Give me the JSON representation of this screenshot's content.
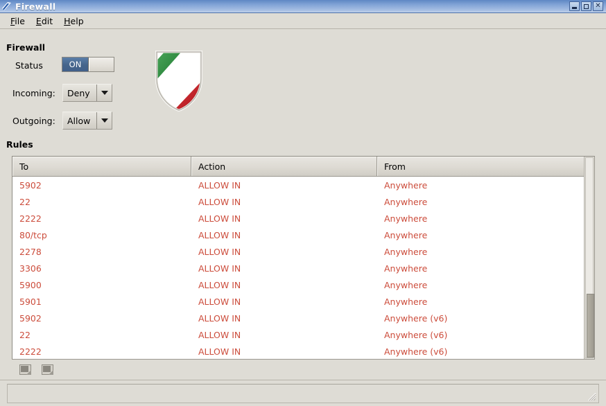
{
  "window": {
    "title": "Firewall",
    "icon": "firewall-app-icon",
    "controls": {
      "minimize": "minimize-icon",
      "maximize": "maximize-icon",
      "close": "close-icon"
    }
  },
  "menubar": {
    "items": [
      {
        "label": "File",
        "mnemonic": "F"
      },
      {
        "label": "Edit",
        "mnemonic": "E"
      },
      {
        "label": "Help",
        "mnemonic": "H"
      }
    ]
  },
  "firewall": {
    "section_title": "Firewall",
    "status": {
      "label": "Status",
      "toggle_value": "ON",
      "enabled": true
    },
    "incoming": {
      "label": "Incoming:",
      "value": "Deny"
    },
    "outgoing": {
      "label": "Outgoing:",
      "value": "Allow"
    },
    "logo": {
      "name": "shield-logo",
      "colors": {
        "green": "#3f9a4e",
        "white": "#ffffff",
        "red": "#c7262b"
      }
    }
  },
  "rules": {
    "section_title": "Rules",
    "columns": [
      "To",
      "Action",
      "From"
    ],
    "rows": [
      {
        "to": "5902",
        "action": "ALLOW IN",
        "from": "Anywhere"
      },
      {
        "to": "22",
        "action": "ALLOW IN",
        "from": "Anywhere"
      },
      {
        "to": "2222",
        "action": "ALLOW IN",
        "from": "Anywhere"
      },
      {
        "to": "80/tcp",
        "action": "ALLOW IN",
        "from": "Anywhere"
      },
      {
        "to": "2278",
        "action": "ALLOW IN",
        "from": "Anywhere"
      },
      {
        "to": "3306",
        "action": "ALLOW IN",
        "from": "Anywhere"
      },
      {
        "to": "5900",
        "action": "ALLOW IN",
        "from": "Anywhere"
      },
      {
        "to": "5901",
        "action": "ALLOW IN",
        "from": "Anywhere"
      },
      {
        "to": "5902",
        "action": "ALLOW IN",
        "from": "Anywhere (v6)"
      },
      {
        "to": "22",
        "action": "ALLOW IN",
        "from": "Anywhere (v6)"
      },
      {
        "to": "2222",
        "action": "ALLOW IN",
        "from": "Anywhere (v6)"
      }
    ],
    "row_text_color": "#cc4c3b",
    "scrollbar": {
      "thumb_top_pct": 68,
      "thumb_height_pct": 32
    }
  },
  "toolbar": {
    "buttons": [
      {
        "name": "add-rule-button",
        "icon": "broken-image-icon"
      },
      {
        "name": "remove-rule-button",
        "icon": "broken-image-icon"
      }
    ]
  },
  "statusbar": {
    "text": "",
    "grip": "resize-grip-icon"
  }
}
